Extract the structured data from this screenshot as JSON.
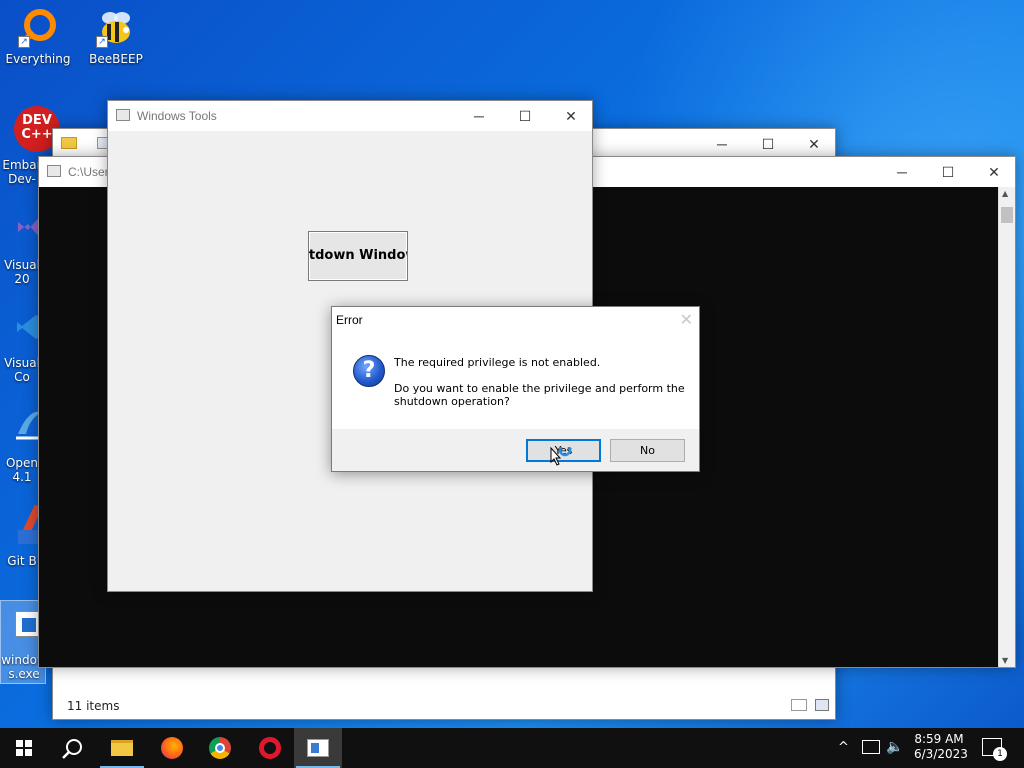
{
  "desktop": {
    "icons": [
      {
        "label": "Everything"
      },
      {
        "label": "BeeBEEP"
      }
    ],
    "partial_labels": [
      {
        "line1": "Embar",
        "line2": "Dev-"
      },
      {
        "line1": "Visual",
        "line2": "20"
      },
      {
        "line1": "Visual",
        "line2": "Co"
      },
      {
        "line1": "Open",
        "line2": "4.1"
      },
      {
        "line1": "Git B",
        "line2": ""
      },
      {
        "line1": "window",
        "line2": "s.exe"
      }
    ],
    "dev_badge": "DEV\nC++"
  },
  "explorer": {
    "status_items": "11 items"
  },
  "console": {
    "title": "C:\\Users"
  },
  "tools_window": {
    "title": "Windows Tools",
    "shutdown_label": "Shutdown Windows"
  },
  "error_dialog": {
    "title": "Error",
    "line1": "The required privilege is not enabled.",
    "line2": "Do you want to enable the privilege and perform the",
    "line3": "shutdown operation?",
    "yes_label": "Yes",
    "no_label": "No"
  },
  "taskbar": {
    "time": "8:59 AM",
    "date": "6/3/2023",
    "notification_count": "1"
  },
  "colors": {
    "accent": "#0078d7",
    "taskbar": "#101010"
  }
}
